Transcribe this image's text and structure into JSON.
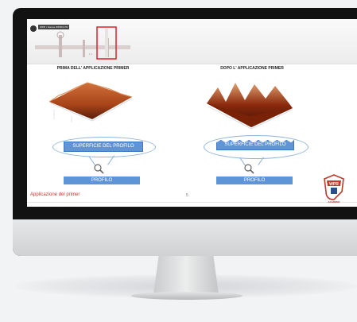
{
  "header": {
    "doc_tag": "WPR • Source WPR01 PR"
  },
  "slide": {
    "left_title": "PRIMA DELL' APPLICAZIONE PRIMER",
    "right_title": "DOPO L' APPLICAZIONE PRIMER",
    "left_surface_label": "SUPERFICIE DEL PROFILO",
    "right_surface_label": "SUPERFICIE DEL PROFILO",
    "left_profile_label": "PROFILO",
    "right_profile_label": "PROFILO"
  },
  "footer": {
    "label": "Applicazione del primer",
    "page": "5"
  },
  "brand": {
    "name": "WPR",
    "sub": "ACADEMY"
  },
  "colors": {
    "accent_blue": "#5f95d6",
    "accent_red": "#c0392b",
    "highlight_red": "#e02020"
  },
  "icons": [
    "magnifier-icon",
    "wpr-shield-logo"
  ]
}
